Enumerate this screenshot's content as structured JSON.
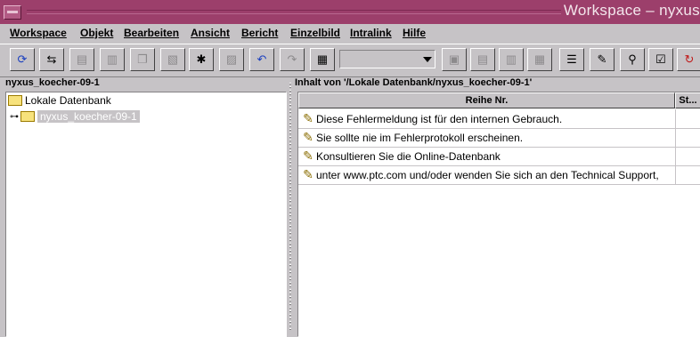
{
  "window": {
    "title": "Workspace – nyxus"
  },
  "menu": [
    {
      "label": "Workspace"
    },
    {
      "label": "Objekt"
    },
    {
      "label": "Bearbeiten"
    },
    {
      "label": "Ansicht"
    },
    {
      "label": "Bericht"
    },
    {
      "label": "Einzelbild"
    },
    {
      "label": "Intralink"
    },
    {
      "label": "Hilfe"
    }
  ],
  "toolbar": {
    "buttons": [
      {
        "icon": "refresh-icon",
        "glyph": "⟳",
        "enabled": true
      },
      {
        "icon": "workspace-sync-icon",
        "glyph": "⇆",
        "enabled": true
      },
      {
        "icon": "checkin-icon",
        "glyph": "▤",
        "enabled": false
      },
      {
        "icon": "document-icon",
        "glyph": "▥",
        "enabled": false
      },
      {
        "icon": "copy-icon",
        "glyph": "❐",
        "enabled": false
      },
      {
        "icon": "paste-icon",
        "glyph": "▧",
        "enabled": false
      },
      {
        "icon": "new-object-icon",
        "glyph": "✱",
        "enabled": true
      },
      {
        "icon": "stack-icon",
        "glyph": "▨",
        "enabled": false
      },
      {
        "icon": "undo-icon",
        "glyph": "↶",
        "enabled": true
      },
      {
        "icon": "redo-icon",
        "glyph": "↷",
        "enabled": false
      },
      {
        "icon": "table-view-icon",
        "glyph": "▦",
        "enabled": true
      },
      {
        "icon": "tool-a-icon",
        "glyph": "▣",
        "enabled": false
      },
      {
        "icon": "tool-b-icon",
        "glyph": "▤",
        "enabled": false
      },
      {
        "icon": "tool-c-icon",
        "glyph": "▥",
        "enabled": false
      },
      {
        "icon": "tool-d-icon",
        "glyph": "▦",
        "enabled": false
      },
      {
        "icon": "list-icon",
        "glyph": "☰",
        "enabled": true
      },
      {
        "icon": "sticky-note-icon",
        "glyph": "✎",
        "enabled": true
      },
      {
        "icon": "binoculars-icon",
        "glyph": "⚲",
        "enabled": true
      },
      {
        "icon": "checklist-icon",
        "glyph": "☑",
        "enabled": true
      },
      {
        "icon": "magnet-icon",
        "glyph": "↻",
        "enabled": true
      }
    ],
    "combo_value": ""
  },
  "left": {
    "header": "nyxus_koecher-09-1",
    "tree": {
      "root_label": "Lokale Datenbank",
      "child_label": "nyxus_koecher-09-1"
    }
  },
  "right": {
    "header": "Inhalt von '/Lokale Datenbank/nyxus_koecher-09-1'",
    "columns": [
      "Reihe Nr.",
      "St..."
    ],
    "rows": [
      {
        "text": "Diese Fehlermeldung ist für den internen Gebrauch."
      },
      {
        "text": "Sie sollte nie im Fehlerprotokoll erscheinen."
      },
      {
        "text": "Konsultieren Sie die Online-Datenbank"
      },
      {
        "text": "unter www.ptc.com und/oder wenden Sie sich an den Technical Support,"
      }
    ]
  }
}
